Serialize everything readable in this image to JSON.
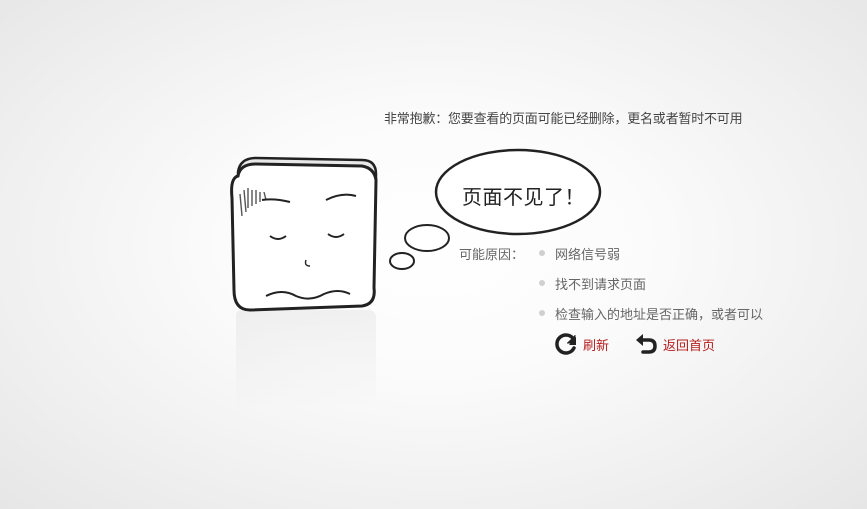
{
  "apology": "非常抱歉：您要查看的页面可能已经删除，更名或者暂时不可用",
  "bubble_text": "页面不见了！",
  "reasons": {
    "label": "可能原因：",
    "items": [
      "网络信号弱",
      "找不到请求页面",
      "检查输入的地址是否正确，或者可以"
    ]
  },
  "actions": {
    "refresh": {
      "label": "刷新",
      "icon": "refresh-icon"
    },
    "home": {
      "label": "返回首页",
      "icon": "return-icon"
    }
  },
  "colors": {
    "link": "#b51d1d",
    "bullet": "#d0d0d0"
  }
}
